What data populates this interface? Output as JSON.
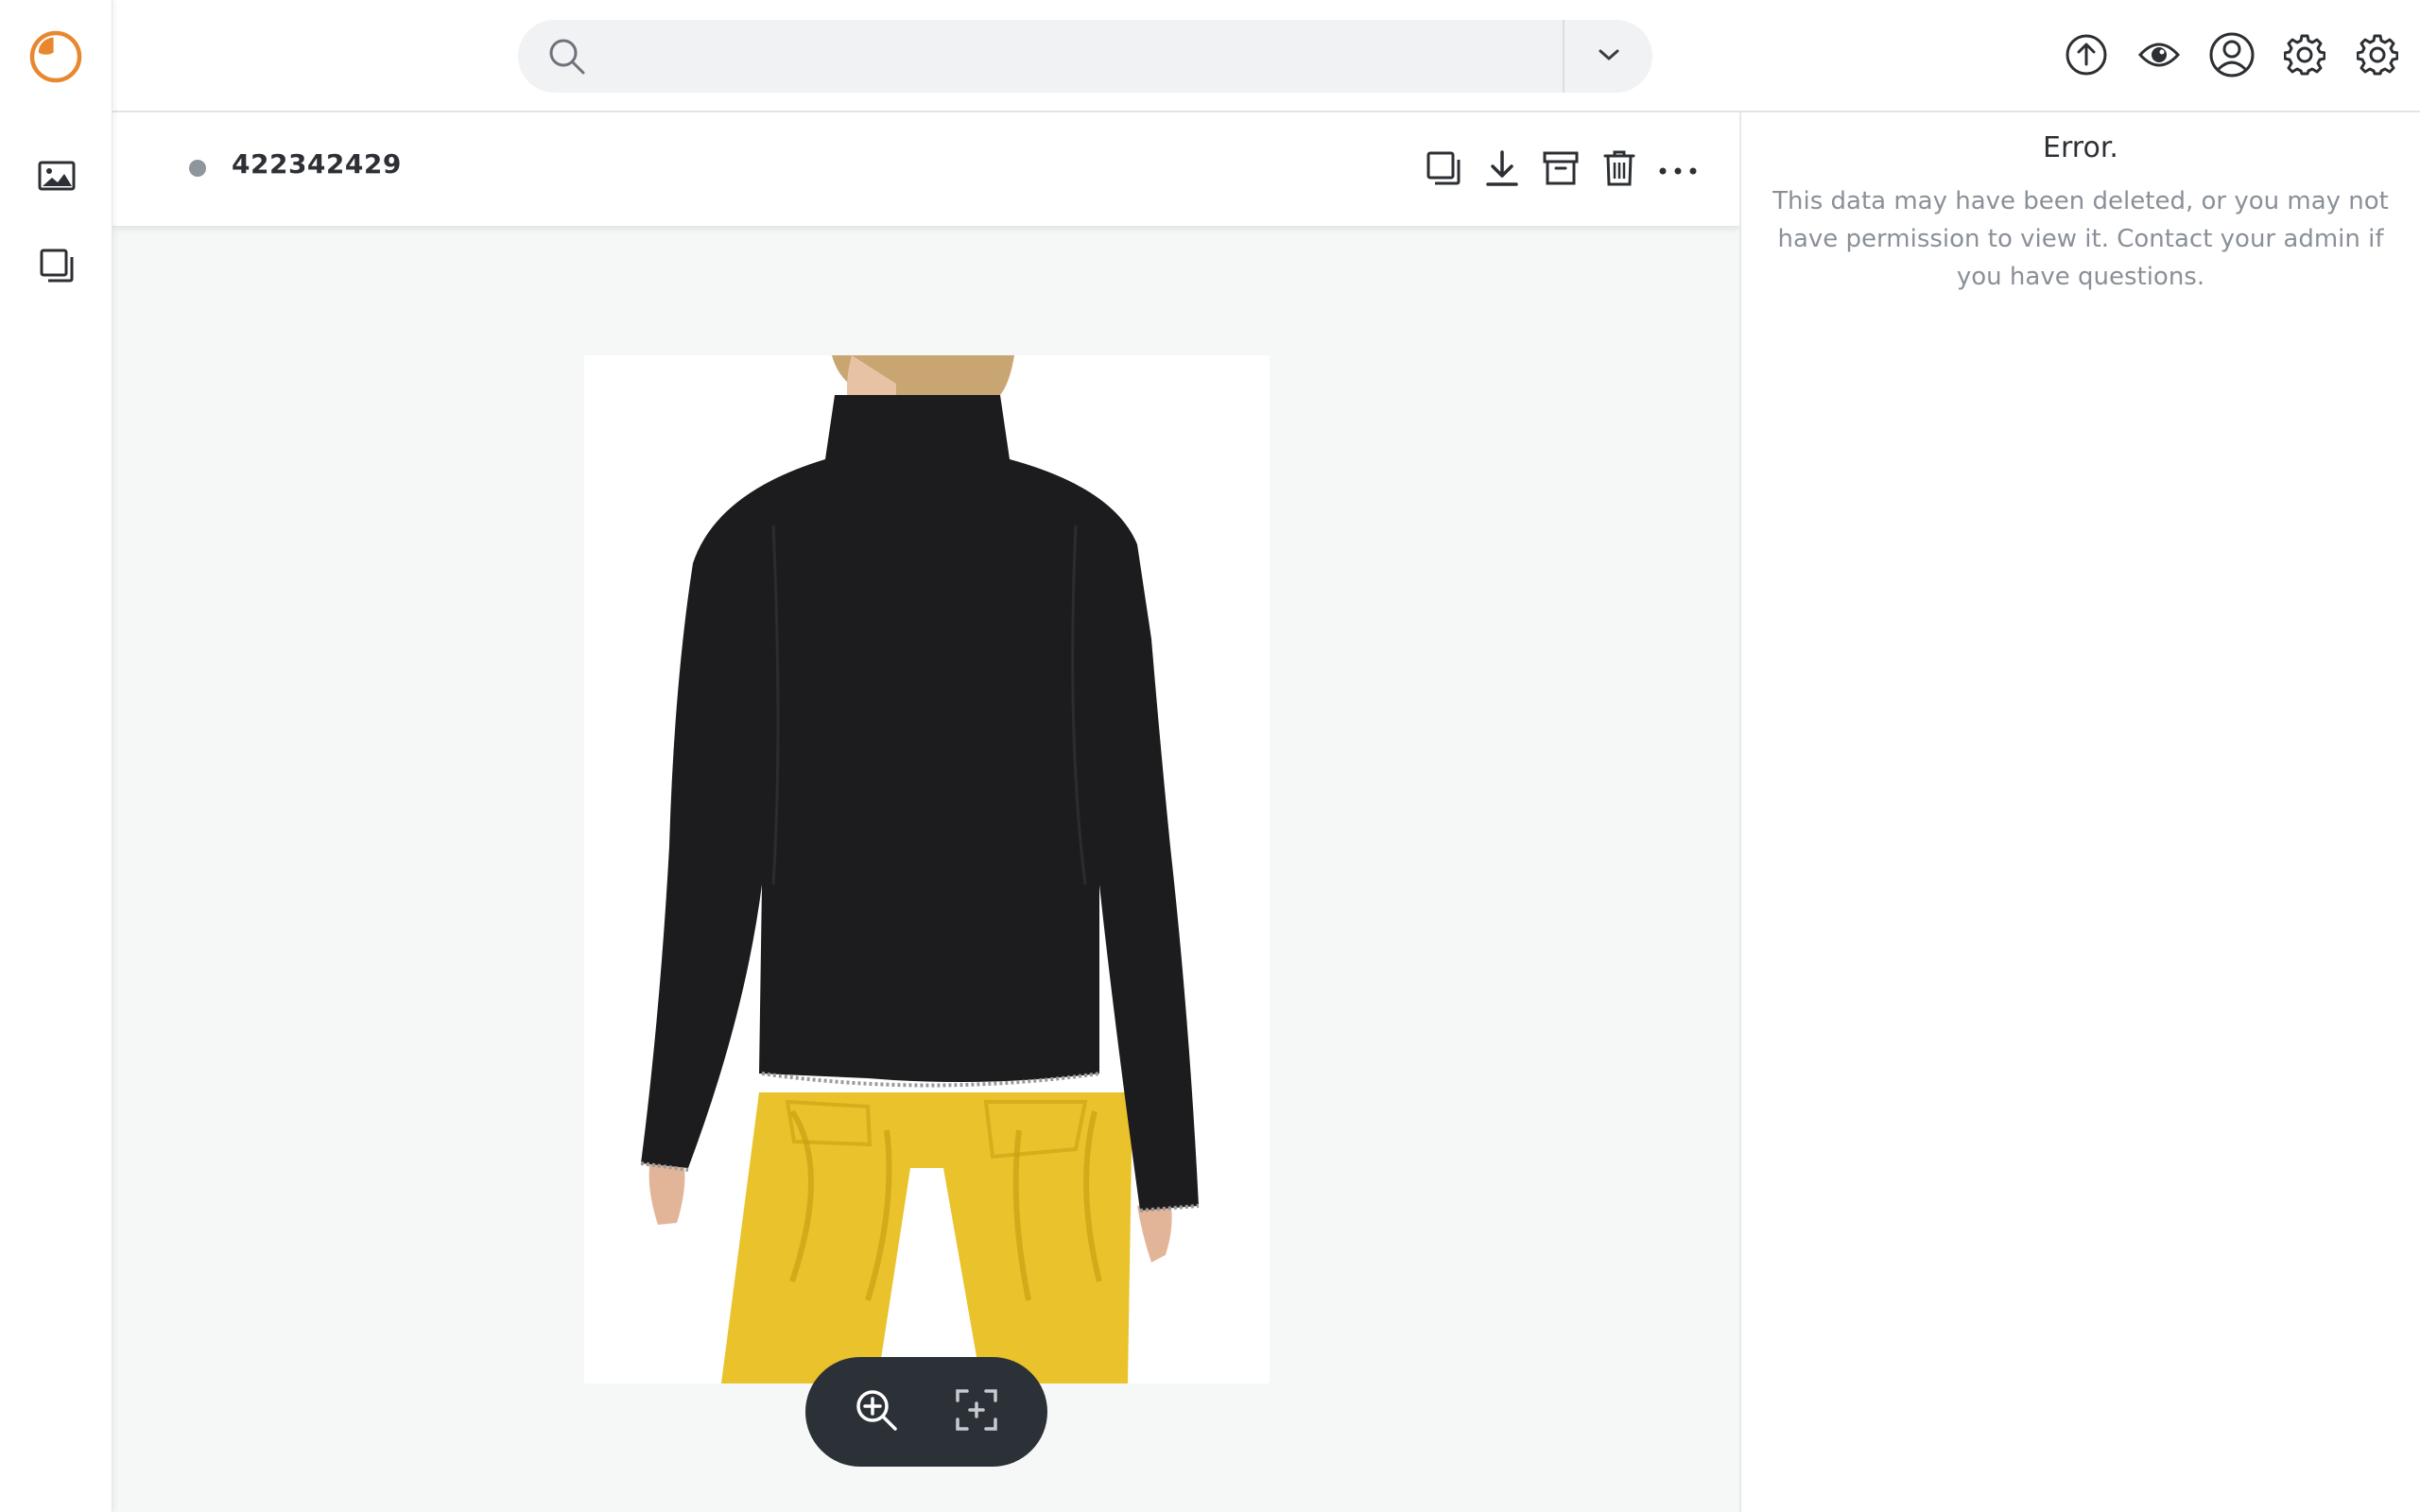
{
  "app": {
    "logo_icon": "app-logo-icon",
    "accent_color": "#e8872e"
  },
  "rail": {
    "items": [
      {
        "icon": "images-icon",
        "label": ""
      },
      {
        "icon": "collections-icon",
        "label": ""
      }
    ]
  },
  "search": {
    "value": "",
    "placeholder": ""
  },
  "toolbar": {
    "icons": [
      "upload-icon",
      "eye-icon",
      "account-icon",
      "settings-icon",
      "admin-settings-icon"
    ]
  },
  "asset": {
    "id": "422342429",
    "status_color": "#8f959c",
    "actions": [
      "copy-icon",
      "download-icon",
      "archive-icon",
      "trash-icon",
      "more-icon"
    ]
  },
  "viewer": {
    "image_subject": "model wearing black turtleneck sweater and yellow pants, back view",
    "zoom_controls": [
      "zoom-in-icon",
      "fit-to-screen-icon"
    ]
  },
  "side_panel": {
    "title": "Error.",
    "message": "This data may have been deleted, or you may not have permission to view it. Contact your admin if you have questions."
  }
}
